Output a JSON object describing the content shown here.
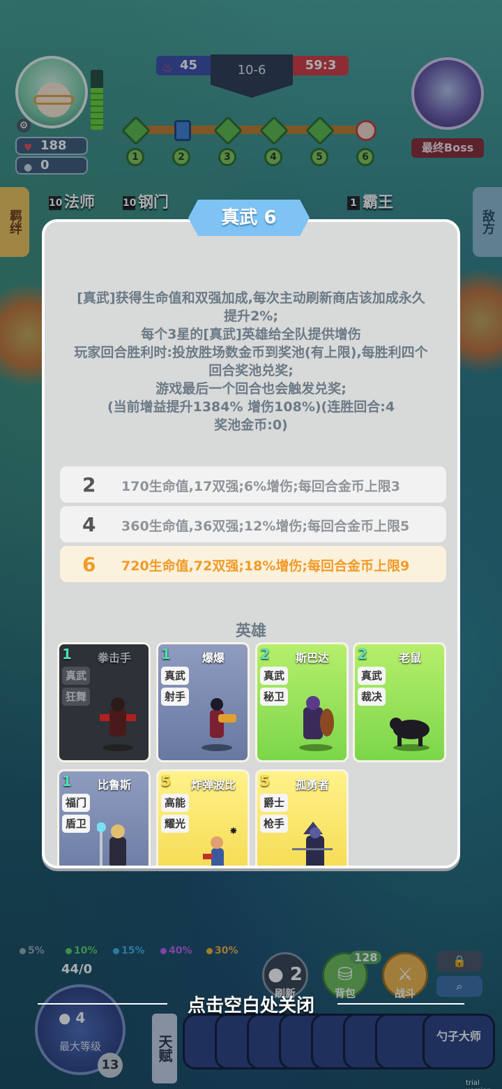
{
  "hud": {
    "player_hp": "188",
    "player_coins": "0",
    "score_left": "45",
    "round": "10-6",
    "score_right": "59:3",
    "stage_nodes": [
      "1",
      "2",
      "3",
      "4",
      "5",
      "6"
    ],
    "boss_label": "最终Boss",
    "left_tab": "羁绊",
    "right_tab": "敌方",
    "trait_strip": [
      {
        "count": "10",
        "name": "法师"
      },
      {
        "count": "10",
        "name": "钢门"
      },
      {
        "count": "1",
        "name": "霸王"
      }
    ]
  },
  "modal": {
    "title": "真武 6",
    "description": [
      "[真武]获得生命值和双强加成,每次主动刷新商店该加成永久",
      "提升2%;",
      "每个3星的[真武]英雄给全队提供增伤",
      "玩家回合胜利时:投放胜场数金币到奖池(有上限),每胜利四个",
      "回合奖池兑奖;",
      "游戏最后一个回合也会触发兑奖;",
      "(当前增益提升1384% 增伤108%)(连胜回合:4",
      "奖池金币:0)"
    ],
    "tiers": [
      {
        "num": "2",
        "text": "170生命值,17双强;6%增伤;每回合金币上限3",
        "active": false
      },
      {
        "num": "4",
        "text": "360生命值,36双强;12%增伤;每回合金币上限5",
        "active": false
      },
      {
        "num": "6",
        "text": "720生命值,72双强;18%增伤;每回合金币上限9",
        "active": true
      }
    ],
    "heroes_title": "英雄",
    "heroes": [
      {
        "cost": "1",
        "name": "拳击手",
        "tags": [
          "真武",
          "狂舞"
        ],
        "style": "gray"
      },
      {
        "cost": "1",
        "name": "爆爆",
        "tags": [
          "真武",
          "射手"
        ],
        "style": "blue"
      },
      {
        "cost": "2",
        "name": "斯巴达",
        "tags": [
          "真武",
          "秘卫"
        ],
        "style": "green"
      },
      {
        "cost": "2",
        "name": "老鼠",
        "tags": [
          "真武",
          "裁决"
        ],
        "style": "green"
      },
      {
        "cost": "1",
        "name": "比鲁斯",
        "tags": [
          "福门",
          "盾卫"
        ],
        "style": "blue"
      },
      {
        "cost": "5",
        "name": "炸弹波比",
        "tags": [
          "高能",
          "耀光"
        ],
        "style": "yellow"
      },
      {
        "cost": "5",
        "name": "孤勇者",
        "tags": [
          "爵士",
          "枪手"
        ],
        "style": "yellow"
      }
    ]
  },
  "bottom": {
    "odds": [
      "5%",
      "10%",
      "15%",
      "40%",
      "30%"
    ],
    "odds_colors": [
      "#9aa6b2",
      "#5ecf6a",
      "#3fb0e8",
      "#c45cf0",
      "#f2b33a"
    ],
    "xp": "44/0",
    "level_cost": "4",
    "level_label": "最大等级",
    "level": "13",
    "refresh_cost": "2",
    "refresh_label": "刷新",
    "bag_label": "背包",
    "bag_count": "128",
    "fight_label": "战斗",
    "talent_label": "天赋",
    "talent_last": "勺子大师",
    "close_hint": "点击空白处关闭",
    "watermark": "trial version"
  }
}
